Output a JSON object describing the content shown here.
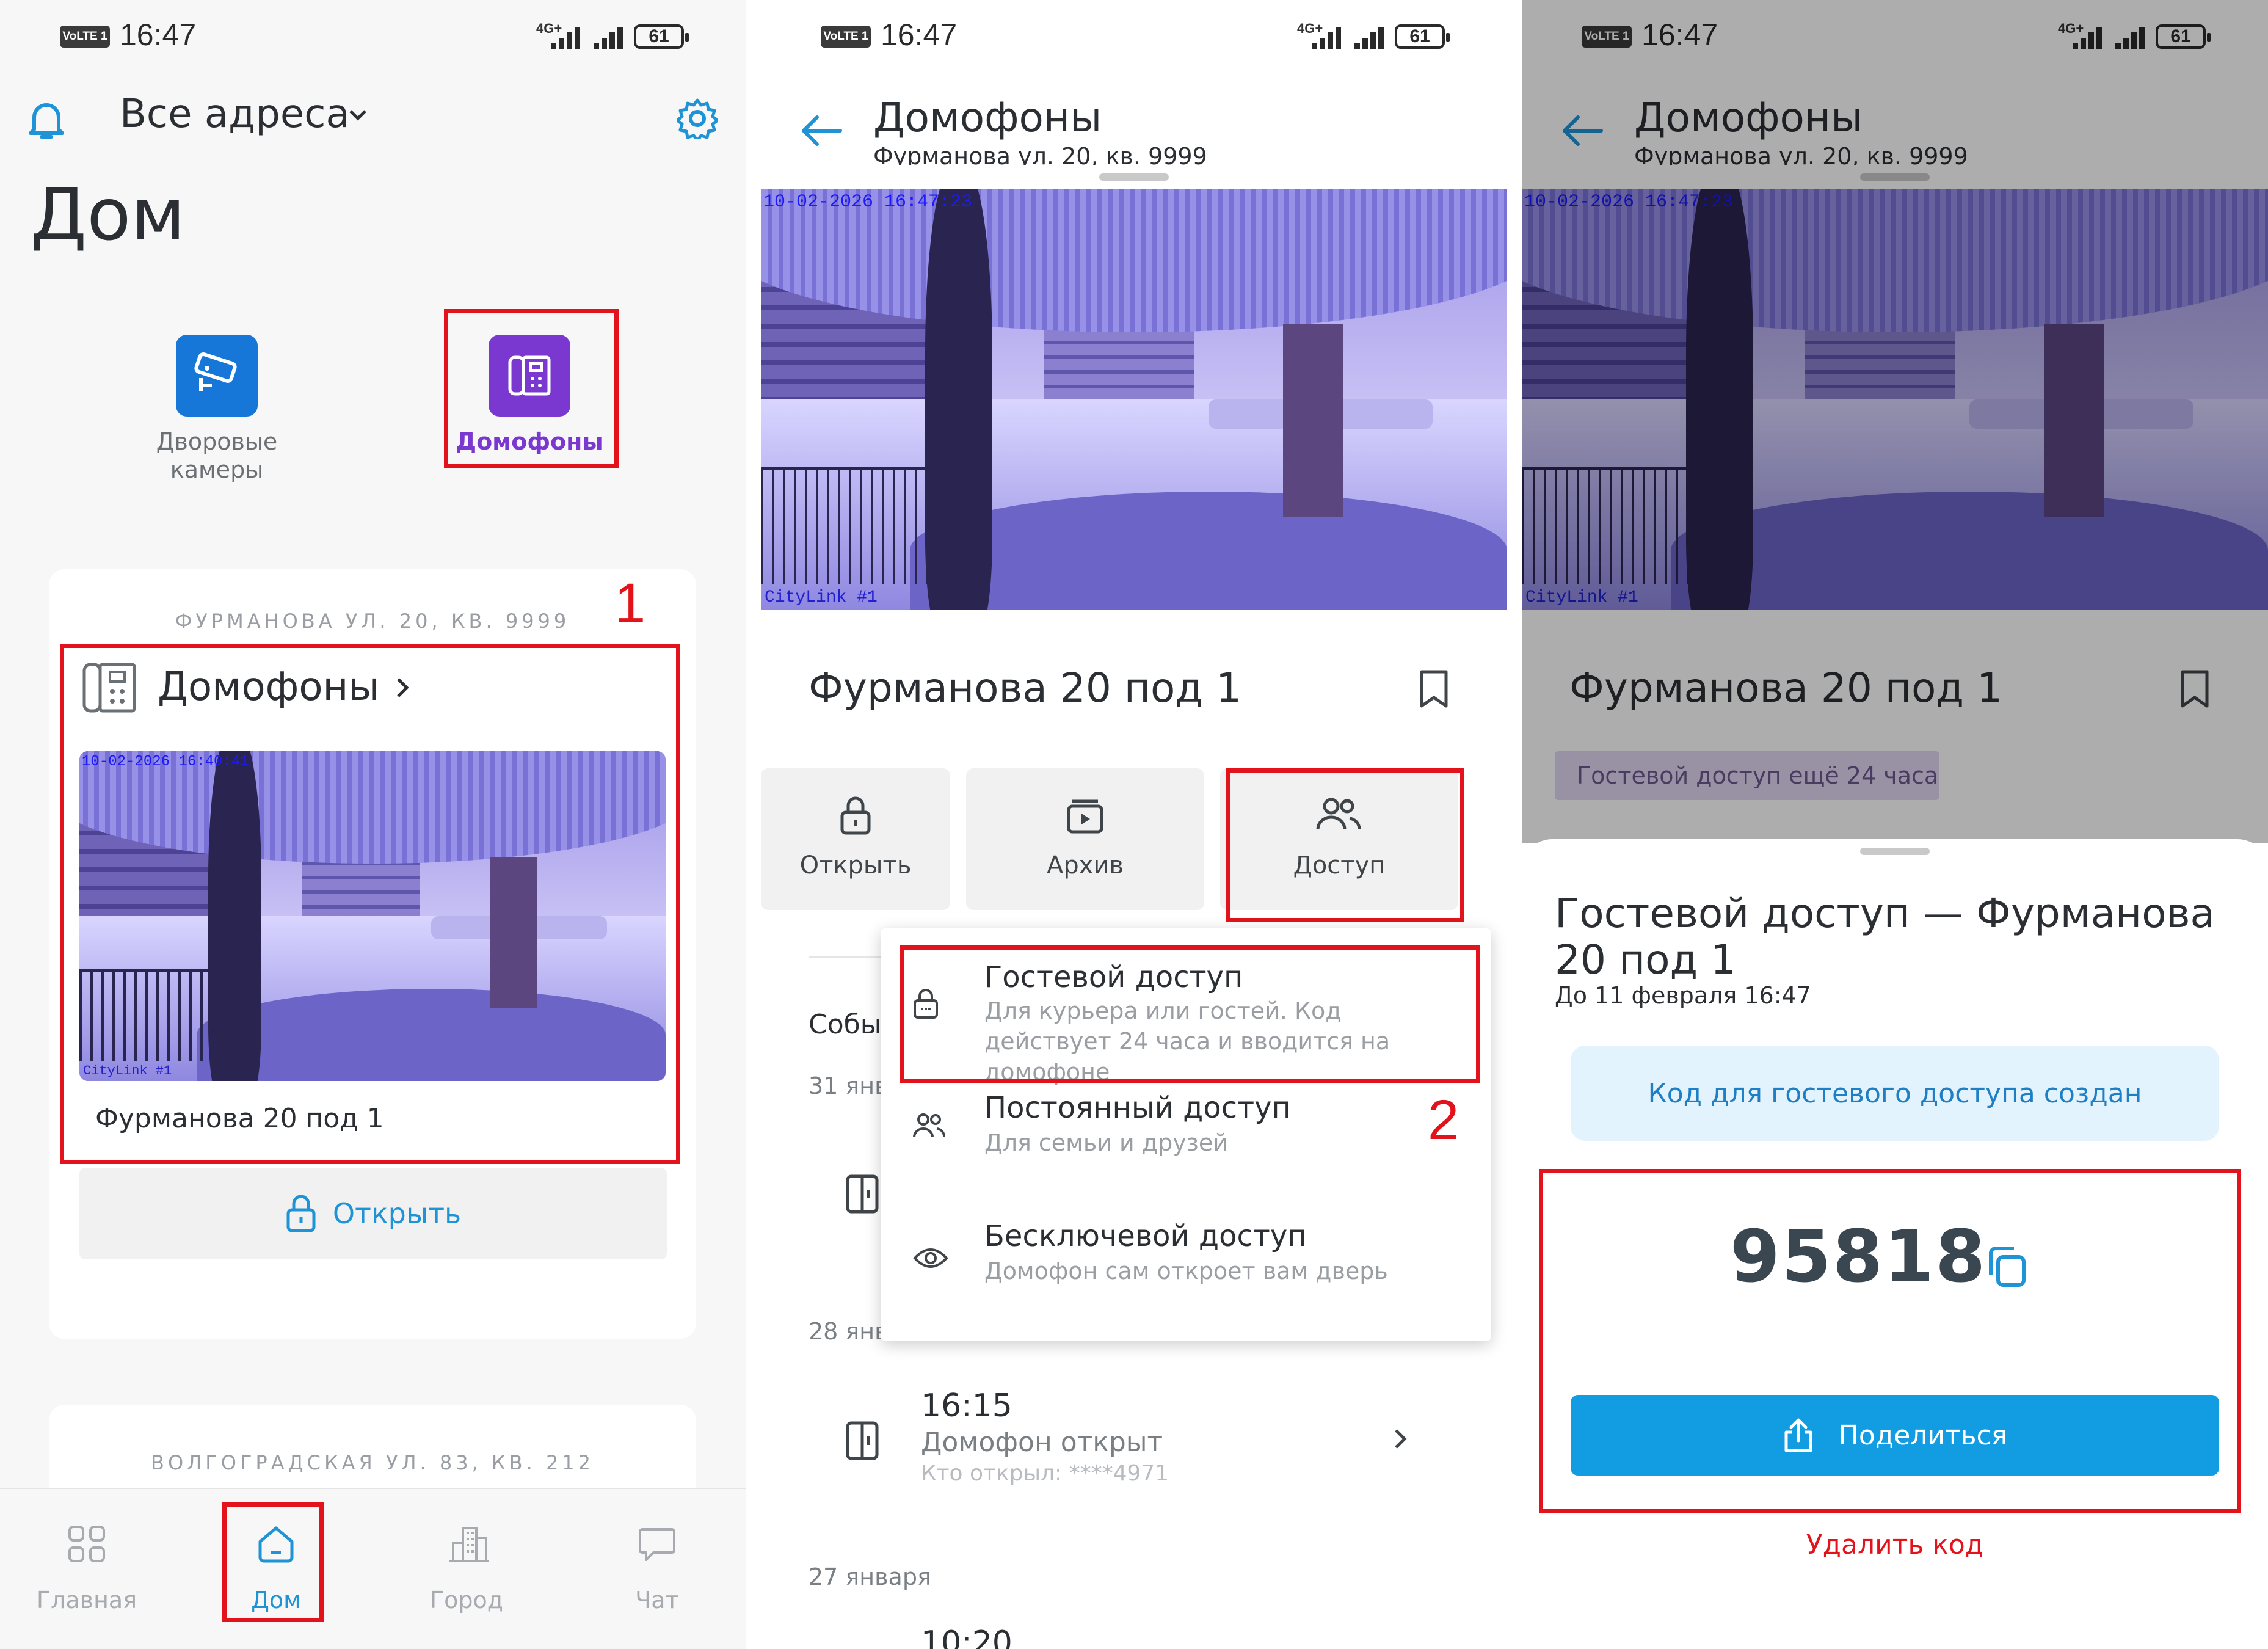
{
  "status_bar": {
    "time": "16:47",
    "volte": "VoLTE 1",
    "network": "4G+",
    "battery": "61"
  },
  "screen1": {
    "address_selector": "Все адреса",
    "page_title": "Дом",
    "tiles": [
      {
        "label": "Дворовые камеры",
        "icon": "security-camera-icon",
        "color": "#1677d8"
      },
      {
        "label": "Домофоны",
        "icon": "intercom-icon",
        "color": "#7b38d0"
      }
    ],
    "card1": {
      "address": "ФУРМАНОВА УЛ. 20, КВ. 9999",
      "section_title": "Домофоны",
      "camera_timestamp": "10-02-2026 16:40:41",
      "camera_watermark": "CityLink #1",
      "camera_name": "Фурманова 20 под 1",
      "open_button": "Открыть"
    },
    "card2": {
      "address": "ВОЛГОГРАДСКАЯ УЛ. 83, КВ. 212"
    },
    "annotation_1": "1",
    "bottom_nav": [
      {
        "label": "Главная",
        "icon": "grid-icon",
        "active": false
      },
      {
        "label": "Дом",
        "icon": "home-icon",
        "active": true
      },
      {
        "label": "Город",
        "icon": "city-icon",
        "active": false
      },
      {
        "label": "Чат",
        "icon": "chat-icon",
        "active": false
      }
    ]
  },
  "screen2": {
    "header_title": "Домофоны",
    "header_subtitle": "Фурманова ул. 20, кв. 9999",
    "camera_timestamp": "10-02-2026 16:47:23",
    "camera_watermark": "CityLink #1",
    "camera_name": "Фурманова 20 под 1",
    "actions": [
      {
        "label": "Открыть",
        "icon": "lock-icon"
      },
      {
        "label": "Архив",
        "icon": "archive-play-icon"
      },
      {
        "label": "Доступ",
        "icon": "people-icon"
      }
    ],
    "events_label": "Собы",
    "event_dates": [
      "31 янв",
      "28 янв",
      "27 января"
    ],
    "event": {
      "time": "16:15",
      "title": "Домофон открыт",
      "subtitle": "Кто открыл: ****4971"
    },
    "event_partial_time": "10:20",
    "annotation_2": "2",
    "menu": [
      {
        "title": "Гостевой доступ",
        "desc": "Для курьера или гостей. Код действует 24 часа и вводится на домофоне",
        "icon": "lock-icon"
      },
      {
        "title": "Постоянный доступ",
        "desc": "Для семьи и друзей",
        "icon": "people-icon"
      },
      {
        "title": "Бесключевой доступ",
        "desc": "Домофон сам откроет вам дверь",
        "icon": "eye-icon"
      }
    ]
  },
  "screen3": {
    "header_title": "Домофоны",
    "header_subtitle": "Фурманова ул. 20, кв. 9999",
    "camera_timestamp": "10-02-2026 16:47:23",
    "camera_watermark": "CityLink #1",
    "camera_name": "Фурманова 20 под 1",
    "badge": "Гостевой доступ ещё 24 часа",
    "sheet_title": "Гостевой доступ — Фурманова 20 под 1",
    "sheet_subtitle": "До 11 февраля 16:47",
    "info_message": "Код для гостевого доступа создан",
    "code": "95818",
    "share_button": "Поделиться",
    "delete_link": "Удалить код"
  },
  "colors": {
    "accent": "#1e93d6",
    "highlight": "#e3131b",
    "intercom": "#7b38d0",
    "camera": "#1677d8",
    "share": "#129de2"
  }
}
